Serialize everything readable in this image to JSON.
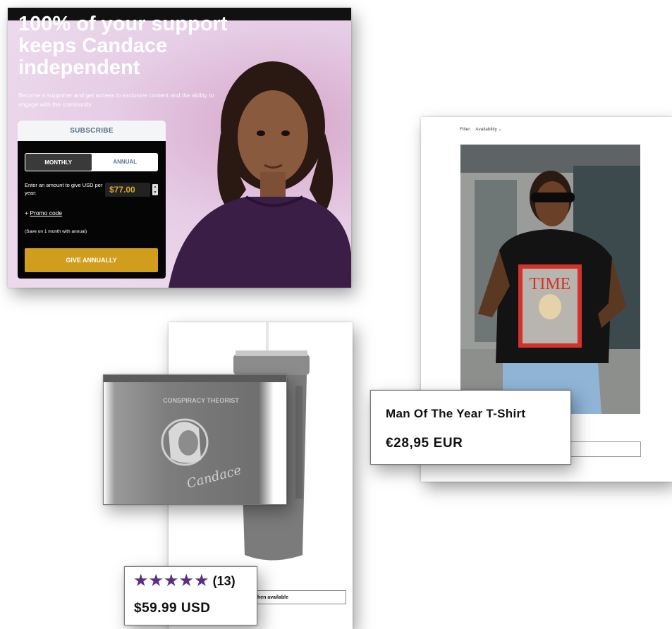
{
  "subscribe_panel": {
    "headline": "100% of your support keeps Candace independent",
    "subline": "Become a supporter and get access to exclusive content and the ability to engage with the community",
    "form": {
      "header": "SUBSCRIBE",
      "toggle_monthly": "MONTHLY",
      "toggle_annual": "ANNUAL",
      "selected_plan": "MONTHLY",
      "amount_label": "Enter an amount to give USD per year:",
      "amount_value": "$77.00",
      "promo_prefix": "+ ",
      "promo_link": "Promo code",
      "save_note": "(Save on 1 month with annual)",
      "give_button": "GIVE ANNUALLY"
    },
    "colors": {
      "accent_gold": "#d19d1c",
      "amount_gold": "#d8a62c",
      "bg_pink": "#e9d2e9"
    }
  },
  "shirt_panel": {
    "filter_label": "Filter:",
    "filter_value": "Availability",
    "filter_chevron": "⌄",
    "product_title": "Man Of The Year T-Shirt",
    "product_price": "€28,95 EUR"
  },
  "tumbler_panel": {
    "cta_text": "hen available",
    "engraving_text_top": "CONSPIRACY THEORIST",
    "engraving_signature": "Candace",
    "rating_stars": 5,
    "review_count": "(13)",
    "price": "$59.99 USD",
    "star_color": "#5a2e84"
  }
}
